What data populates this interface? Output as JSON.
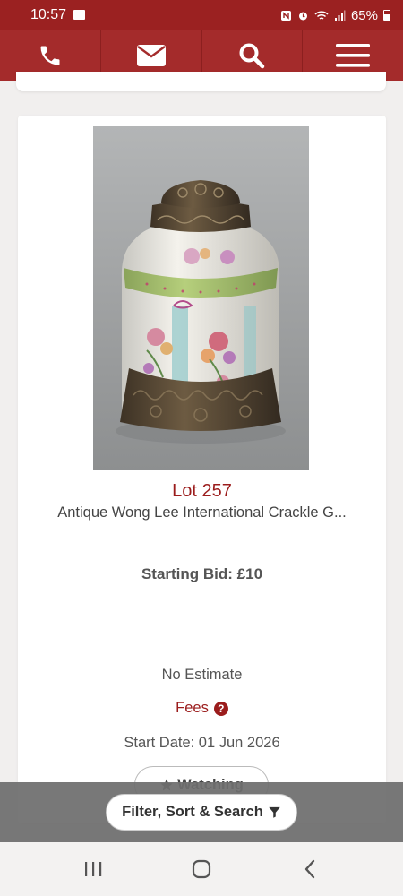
{
  "status_bar": {
    "time": "10:57",
    "battery_text": "65%",
    "icons": [
      "folder-icon",
      "nfc-icon",
      "alarm-icon",
      "wifi-icon",
      "signal-icon",
      "battery-icon"
    ]
  },
  "nav": {
    "items": [
      {
        "icon": "phone-icon"
      },
      {
        "icon": "mail-icon"
      },
      {
        "icon": "search-icon"
      },
      {
        "icon": "menu-icon"
      }
    ]
  },
  "lot": {
    "number_label": "Lot 257",
    "title": "Antique Wong Lee International Crackle G...",
    "starting_bid": "Starting Bid: £10",
    "estimate": "No Estimate",
    "fees_label": "Fees",
    "start_date": "Start Date: 01 Jun 2026",
    "watch_label": "Watching"
  },
  "filter": {
    "label": "Filter, Sort & Search"
  },
  "colors": {
    "brand": "#a42b2b",
    "status_bar": "#9b2121",
    "accent_text": "#9b1c1c"
  }
}
